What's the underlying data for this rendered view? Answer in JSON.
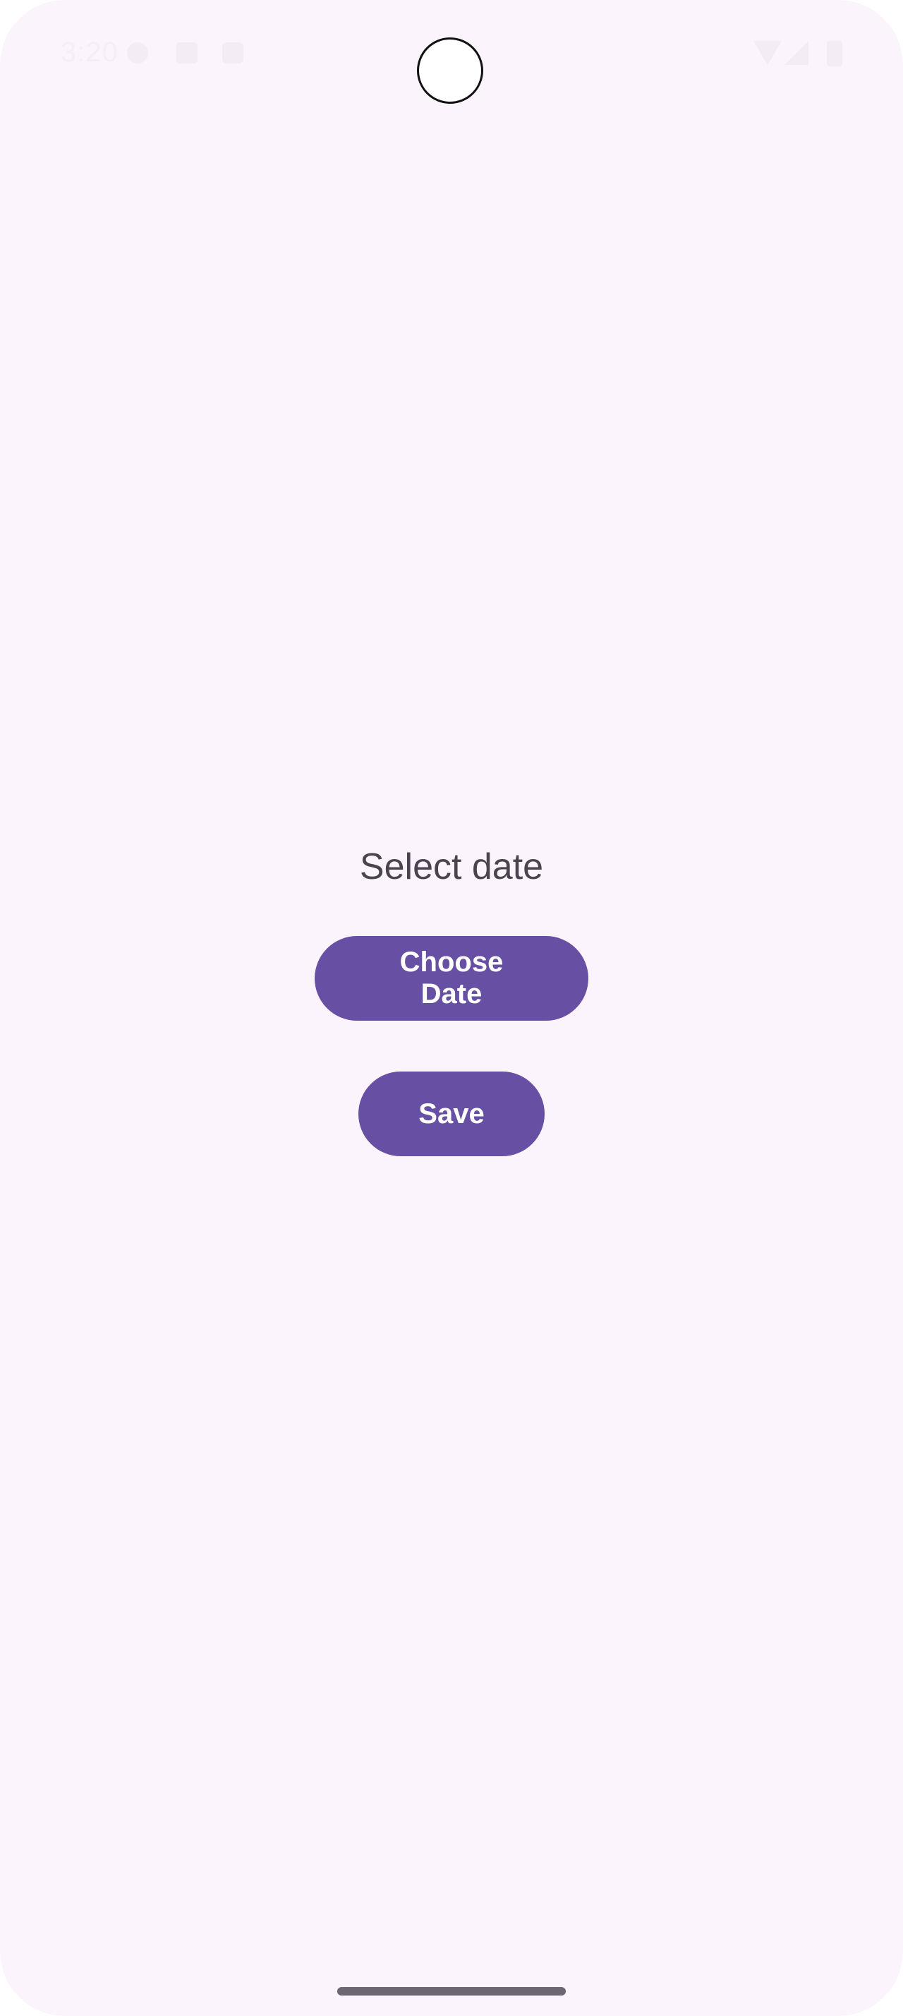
{
  "status_bar": {
    "time": "3:20",
    "icons": [
      "notification-icon",
      "sd-card-icon",
      "photo-icon",
      "wifi-icon",
      "cell-signal-icon",
      "battery-icon"
    ]
  },
  "main": {
    "title": "Select date",
    "choose_date_label": "Choose Date",
    "save_label": "Save"
  },
  "colors": {
    "background": "#fcf4fc",
    "button": "#6750a4",
    "title_text": "#4a4450"
  }
}
